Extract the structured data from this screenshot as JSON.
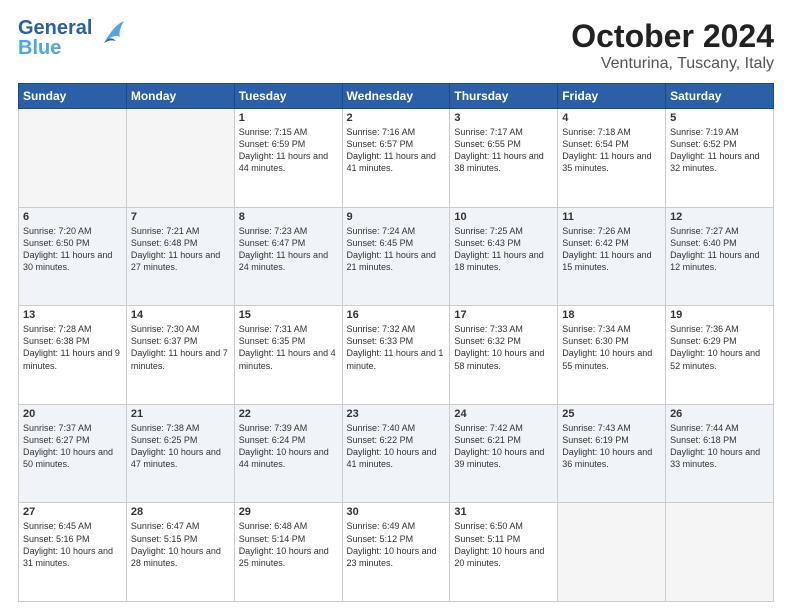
{
  "header": {
    "logo_general": "General",
    "logo_blue": "Blue",
    "title": "October 2024",
    "subtitle": "Venturina, Tuscany, Italy"
  },
  "columns": [
    "Sunday",
    "Monday",
    "Tuesday",
    "Wednesday",
    "Thursday",
    "Friday",
    "Saturday"
  ],
  "weeks": [
    [
      {
        "day": "",
        "info": ""
      },
      {
        "day": "",
        "info": ""
      },
      {
        "day": "1",
        "info": "Sunrise: 7:15 AM\nSunset: 6:59 PM\nDaylight: 11 hours and 44 minutes."
      },
      {
        "day": "2",
        "info": "Sunrise: 7:16 AM\nSunset: 6:57 PM\nDaylight: 11 hours and 41 minutes."
      },
      {
        "day": "3",
        "info": "Sunrise: 7:17 AM\nSunset: 6:55 PM\nDaylight: 11 hours and 38 minutes."
      },
      {
        "day": "4",
        "info": "Sunrise: 7:18 AM\nSunset: 6:54 PM\nDaylight: 11 hours and 35 minutes."
      },
      {
        "day": "5",
        "info": "Sunrise: 7:19 AM\nSunset: 6:52 PM\nDaylight: 11 hours and 32 minutes."
      }
    ],
    [
      {
        "day": "6",
        "info": "Sunrise: 7:20 AM\nSunset: 6:50 PM\nDaylight: 11 hours and 30 minutes."
      },
      {
        "day": "7",
        "info": "Sunrise: 7:21 AM\nSunset: 6:48 PM\nDaylight: 11 hours and 27 minutes."
      },
      {
        "day": "8",
        "info": "Sunrise: 7:23 AM\nSunset: 6:47 PM\nDaylight: 11 hours and 24 minutes."
      },
      {
        "day": "9",
        "info": "Sunrise: 7:24 AM\nSunset: 6:45 PM\nDaylight: 11 hours and 21 minutes."
      },
      {
        "day": "10",
        "info": "Sunrise: 7:25 AM\nSunset: 6:43 PM\nDaylight: 11 hours and 18 minutes."
      },
      {
        "day": "11",
        "info": "Sunrise: 7:26 AM\nSunset: 6:42 PM\nDaylight: 11 hours and 15 minutes."
      },
      {
        "day": "12",
        "info": "Sunrise: 7:27 AM\nSunset: 6:40 PM\nDaylight: 11 hours and 12 minutes."
      }
    ],
    [
      {
        "day": "13",
        "info": "Sunrise: 7:28 AM\nSunset: 6:38 PM\nDaylight: 11 hours and 9 minutes."
      },
      {
        "day": "14",
        "info": "Sunrise: 7:30 AM\nSunset: 6:37 PM\nDaylight: 11 hours and 7 minutes."
      },
      {
        "day": "15",
        "info": "Sunrise: 7:31 AM\nSunset: 6:35 PM\nDaylight: 11 hours and 4 minutes."
      },
      {
        "day": "16",
        "info": "Sunrise: 7:32 AM\nSunset: 6:33 PM\nDaylight: 11 hours and 1 minute."
      },
      {
        "day": "17",
        "info": "Sunrise: 7:33 AM\nSunset: 6:32 PM\nDaylight: 10 hours and 58 minutes."
      },
      {
        "day": "18",
        "info": "Sunrise: 7:34 AM\nSunset: 6:30 PM\nDaylight: 10 hours and 55 minutes."
      },
      {
        "day": "19",
        "info": "Sunrise: 7:36 AM\nSunset: 6:29 PM\nDaylight: 10 hours and 52 minutes."
      }
    ],
    [
      {
        "day": "20",
        "info": "Sunrise: 7:37 AM\nSunset: 6:27 PM\nDaylight: 10 hours and 50 minutes."
      },
      {
        "day": "21",
        "info": "Sunrise: 7:38 AM\nSunset: 6:25 PM\nDaylight: 10 hours and 47 minutes."
      },
      {
        "day": "22",
        "info": "Sunrise: 7:39 AM\nSunset: 6:24 PM\nDaylight: 10 hours and 44 minutes."
      },
      {
        "day": "23",
        "info": "Sunrise: 7:40 AM\nSunset: 6:22 PM\nDaylight: 10 hours and 41 minutes."
      },
      {
        "day": "24",
        "info": "Sunrise: 7:42 AM\nSunset: 6:21 PM\nDaylight: 10 hours and 39 minutes."
      },
      {
        "day": "25",
        "info": "Sunrise: 7:43 AM\nSunset: 6:19 PM\nDaylight: 10 hours and 36 minutes."
      },
      {
        "day": "26",
        "info": "Sunrise: 7:44 AM\nSunset: 6:18 PM\nDaylight: 10 hours and 33 minutes."
      }
    ],
    [
      {
        "day": "27",
        "info": "Sunrise: 6:45 AM\nSunset: 5:16 PM\nDaylight: 10 hours and 31 minutes."
      },
      {
        "day": "28",
        "info": "Sunrise: 6:47 AM\nSunset: 5:15 PM\nDaylight: 10 hours and 28 minutes."
      },
      {
        "day": "29",
        "info": "Sunrise: 6:48 AM\nSunset: 5:14 PM\nDaylight: 10 hours and 25 minutes."
      },
      {
        "day": "30",
        "info": "Sunrise: 6:49 AM\nSunset: 5:12 PM\nDaylight: 10 hours and 23 minutes."
      },
      {
        "day": "31",
        "info": "Sunrise: 6:50 AM\nSunset: 5:11 PM\nDaylight: 10 hours and 20 minutes."
      },
      {
        "day": "",
        "info": ""
      },
      {
        "day": "",
        "info": ""
      }
    ]
  ]
}
